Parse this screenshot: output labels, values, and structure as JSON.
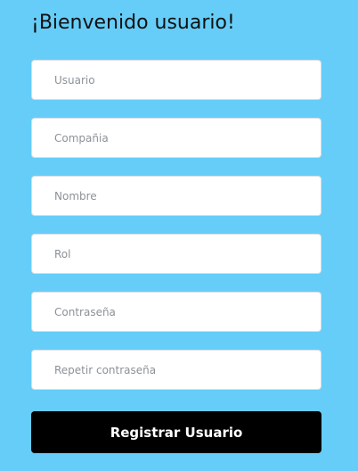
{
  "header": {
    "title": "¡Bienvenido usuario!"
  },
  "form": {
    "fields": [
      {
        "placeholder": "Usuario",
        "value": ""
      },
      {
        "placeholder": "Compañia",
        "value": ""
      },
      {
        "placeholder": "Nombre",
        "value": ""
      },
      {
        "placeholder": "Rol",
        "value": ""
      },
      {
        "placeholder": "Contraseña",
        "value": ""
      },
      {
        "placeholder": "Repetir contraseña",
        "value": ""
      }
    ],
    "submit_label": "Registrar Usuario"
  },
  "colors": {
    "background": "#66cdf8",
    "button": "#000000",
    "button_text": "#ffffff",
    "field_background": "#ffffff"
  }
}
